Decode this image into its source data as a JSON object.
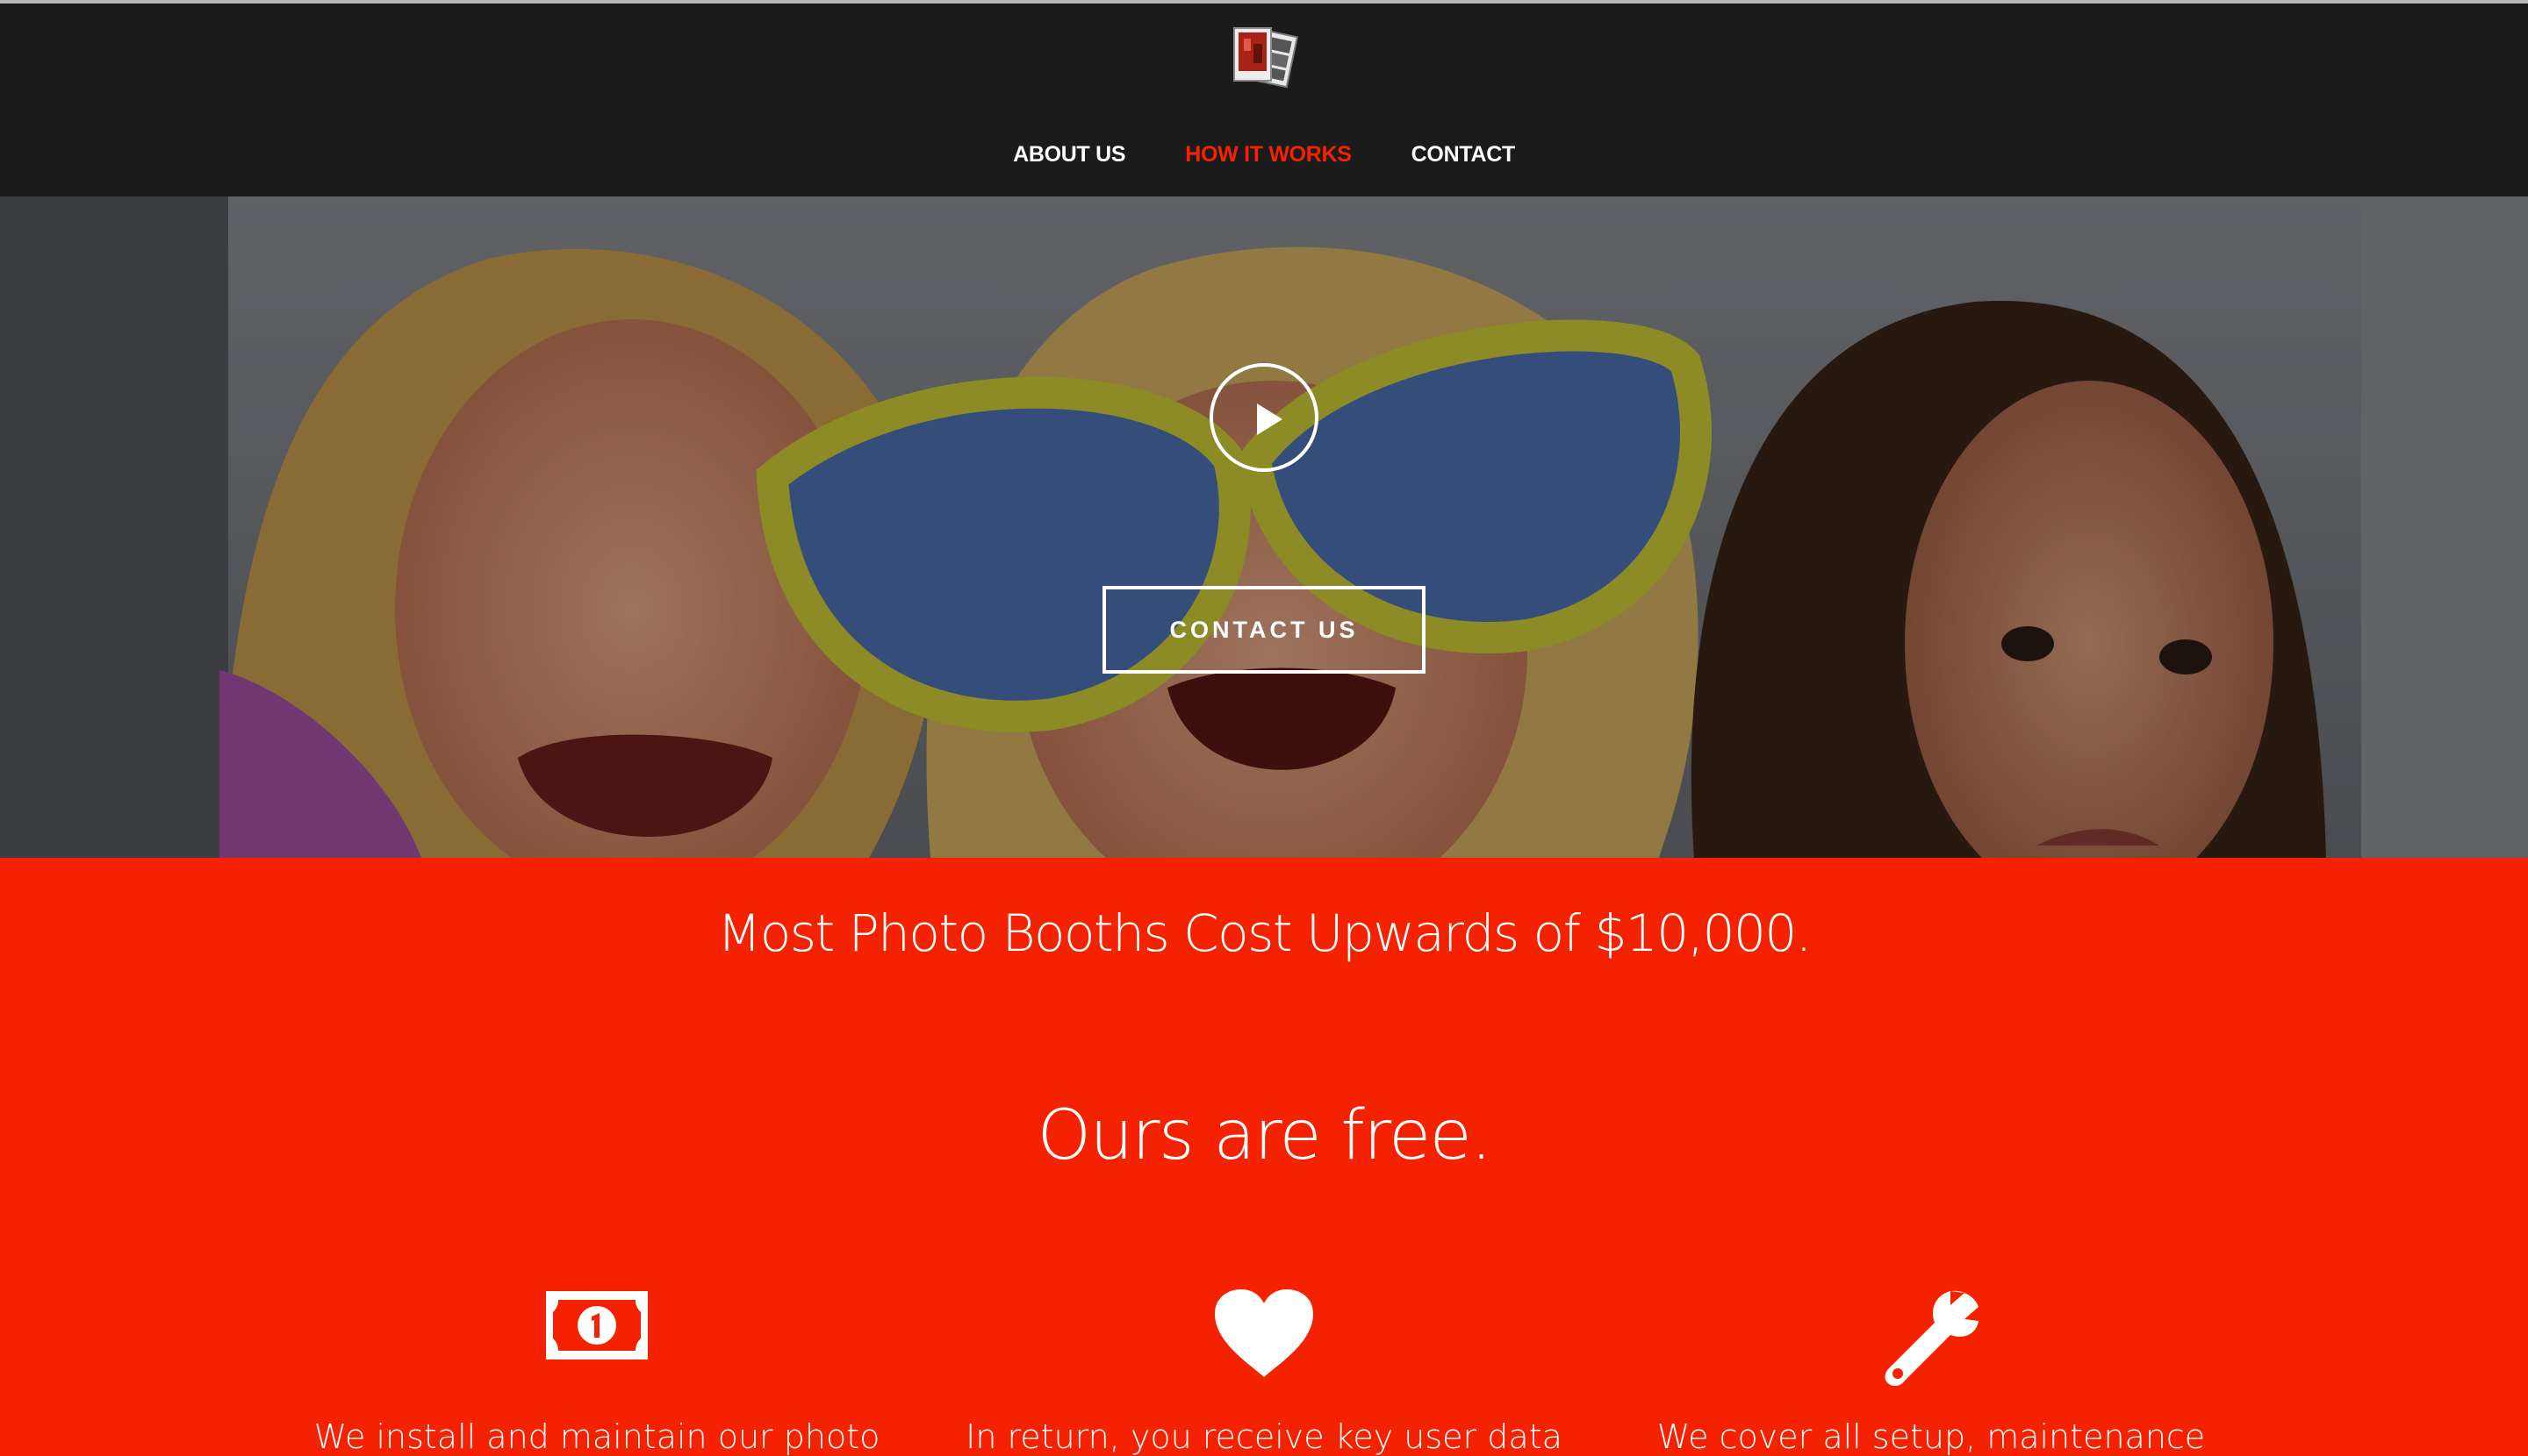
{
  "nav": {
    "links": [
      {
        "label": "ABOUT US",
        "active": false
      },
      {
        "label": "HOW IT WORKS",
        "active": true
      },
      {
        "label": "CONTACT",
        "active": false
      }
    ]
  },
  "hero": {
    "cta_label": "CONTACT US",
    "play_icon": "play-icon"
  },
  "main": {
    "headline": "Most Photo Booths Cost Upwards of $10,000.",
    "subheadline": "Ours are free.",
    "features": [
      {
        "icon": "dollar-bill-icon",
        "text": "We install and maintain our photo"
      },
      {
        "icon": "heart-icon",
        "text": "In return, you receive key user data"
      },
      {
        "icon": "wrench-icon",
        "text": "We cover all setup, maintenance"
      }
    ]
  },
  "colors": {
    "accent": "#f42200",
    "navbar": "#1b1b1b",
    "text_light": "#ffffff"
  }
}
